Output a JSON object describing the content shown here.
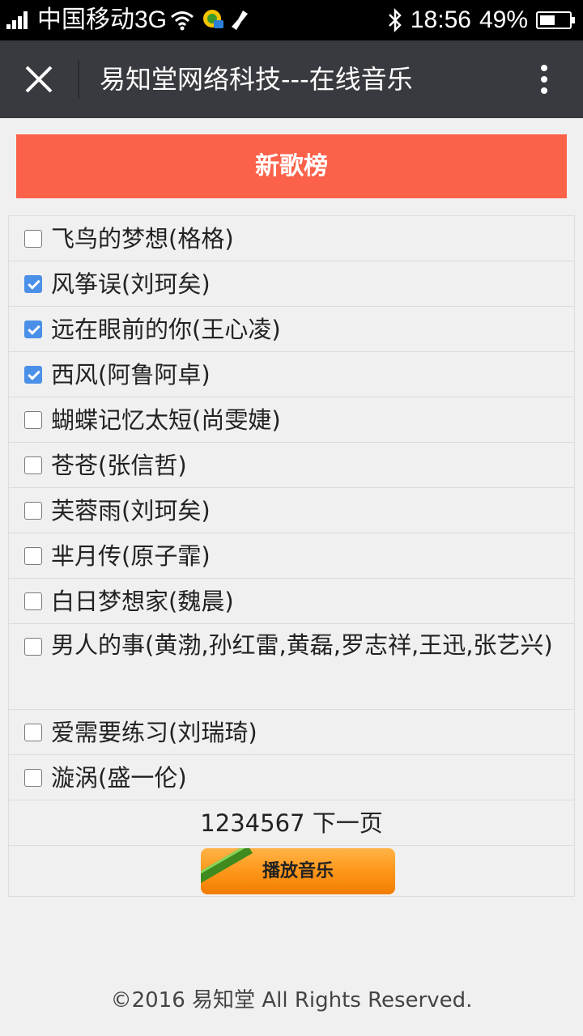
{
  "status_bar": {
    "carrier": "中国移动3G",
    "time": "18:56",
    "battery": "49%",
    "battery_level": 0.49,
    "icons": [
      "signal-icon",
      "wifi-icon",
      "app-notification-icon",
      "cleaner-icon",
      "bluetooth-icon",
      "battery-icon"
    ]
  },
  "title_bar": {
    "title": "易知堂网络科技---在线音乐",
    "close_icon": "close-icon",
    "more_icon": "more-icon"
  },
  "banner": {
    "title": "新歌榜"
  },
  "songs": [
    {
      "label": "飞鸟的梦想(格格)",
      "checked": false
    },
    {
      "label": "风筝误(刘珂矣)",
      "checked": true
    },
    {
      "label": "远在眼前的你(王心凌)",
      "checked": true
    },
    {
      "label": "西风(阿鲁阿卓)",
      "checked": true
    },
    {
      "label": "蝴蝶记忆太短(尚雯婕)",
      "checked": false
    },
    {
      "label": "苍苍(张信哲)",
      "checked": false
    },
    {
      "label": "芙蓉雨(刘珂矣)",
      "checked": false
    },
    {
      "label": "芈月传(原子霏)",
      "checked": false
    },
    {
      "label": "白日梦想家(魏晨)",
      "checked": false
    },
    {
      "label": "男人的事(黄渤,孙红雷,黄磊,罗志祥,王迅,张艺兴)",
      "checked": false
    },
    {
      "label": "爱需要练习(刘瑞琦)",
      "checked": false
    },
    {
      "label": "漩涡(盛一伦)",
      "checked": false
    }
  ],
  "pager": {
    "pages": [
      "1",
      "2",
      "3",
      "4",
      "5",
      "6",
      "7"
    ],
    "next": "下一页"
  },
  "play_button": {
    "label": "播放音乐"
  },
  "footer": {
    "text": "©2016 易知堂 All Rights Reserved."
  }
}
